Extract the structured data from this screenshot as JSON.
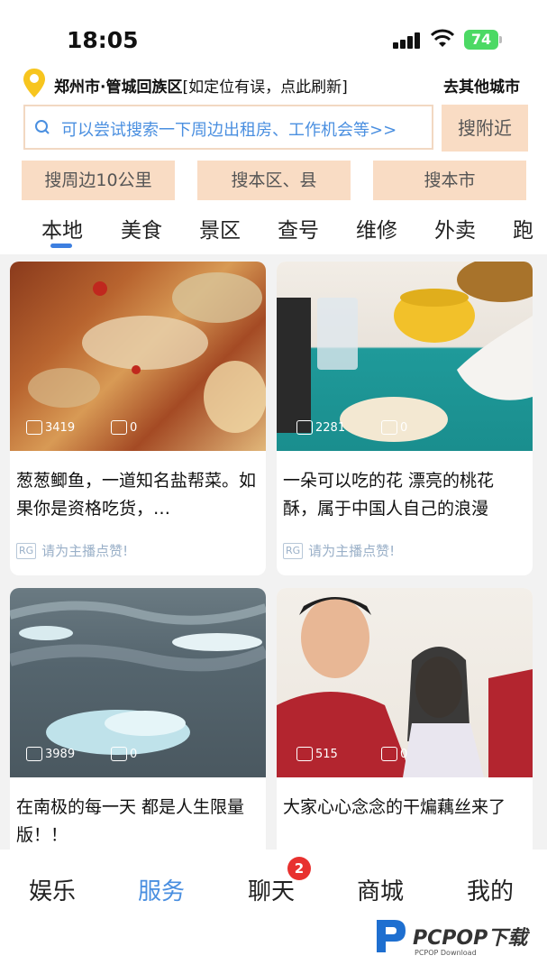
{
  "status_bar": {
    "time": "18:05",
    "battery": "74"
  },
  "location": {
    "city": "郑州市·管城回族区",
    "hint": "[如定位有误，点此刷新]",
    "other_city": "去其他城市"
  },
  "search": {
    "placeholder": "可以尝试搜索一下周边出租房、工作机会等>>",
    "button": "搜附近"
  },
  "chips": [
    "搜周边10公里",
    "搜本区、县",
    "搜本市"
  ],
  "tabs": [
    "本地",
    "美食",
    "景区",
    "查号",
    "维修",
    "外卖",
    "跑"
  ],
  "active_tab": "本地",
  "cards": [
    {
      "likes": "3419",
      "comments": "0",
      "title": "葱葱鲫鱼，一道知名盐帮菜。如果你是资格吃货，…",
      "source": "RG",
      "footer": "请为主播点赞!"
    },
    {
      "likes": "2281",
      "comments": "0",
      "title": "一朵可以吃的花 漂亮的桃花酥，属于中国人自己的浪漫",
      "source": "RG",
      "footer": "请为主播点赞!"
    },
    {
      "likes": "3989",
      "comments": "0",
      "title": "在南极的每一天 都是人生限量版！！"
    },
    {
      "likes": "515",
      "comments": "0",
      "title": "大家心心念念的干煸藕丝来了"
    }
  ],
  "bottom_nav": {
    "items": [
      "娱乐",
      "服务",
      "聊天",
      "商城",
      "我的"
    ],
    "active": "服务",
    "chat_badge": "2"
  },
  "watermark": {
    "text": "PCPOP下载",
    "sub": "PCPOP Download"
  },
  "colors": {
    "accent": "#4a8fe0",
    "chip_bg": "#f9dcc4",
    "badge": "#e8312f"
  }
}
